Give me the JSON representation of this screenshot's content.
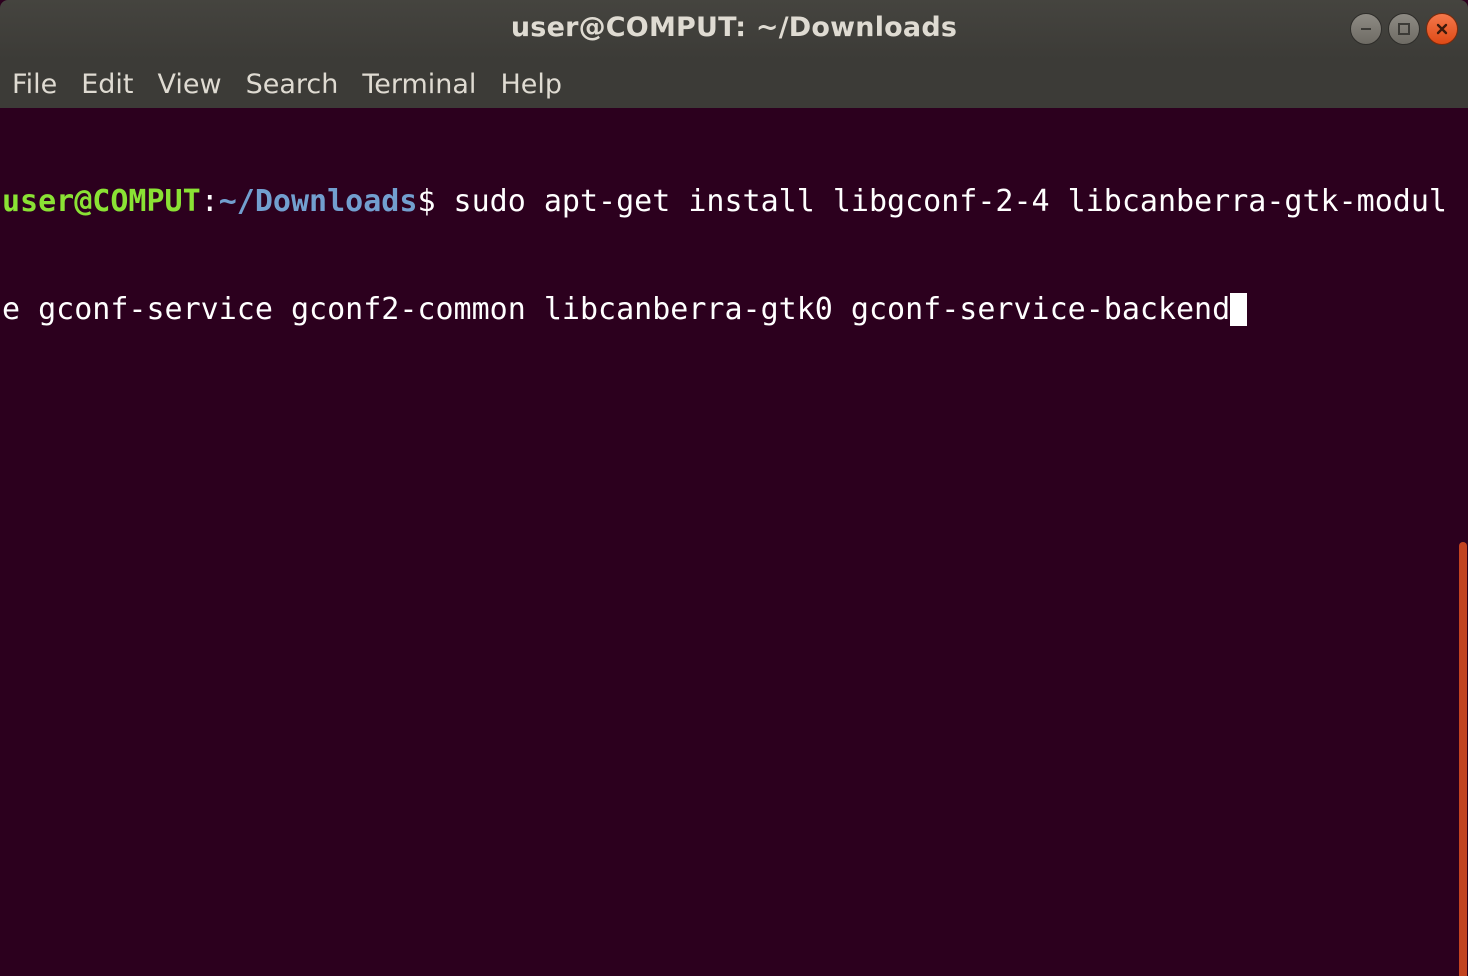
{
  "window": {
    "title": "user@COMPUT: ~/Downloads"
  },
  "menubar": {
    "items": [
      "File",
      "Edit",
      "View",
      "Search",
      "Terminal",
      "Help"
    ]
  },
  "terminal": {
    "prompt_user": "user@COMPUT",
    "prompt_sep": ":",
    "prompt_path": "~/Downloads",
    "prompt_symbol": "$",
    "command_line1": " sudo apt-get install libgconf-2-4 libcanberra-gtk-modul",
    "command_line2": "e gconf-service gconf2-common libcanberra-gtk0 gconf-service-backend"
  },
  "colors": {
    "background": "#2c001e",
    "prompt_user": "#8ae234",
    "prompt_path": "#729fcf",
    "accent": "#e95420"
  },
  "icons": {
    "minimize": "minimize-icon",
    "maximize": "maximize-icon",
    "close": "close-icon"
  },
  "scrollbar": {
    "position_fraction": 0.5
  }
}
